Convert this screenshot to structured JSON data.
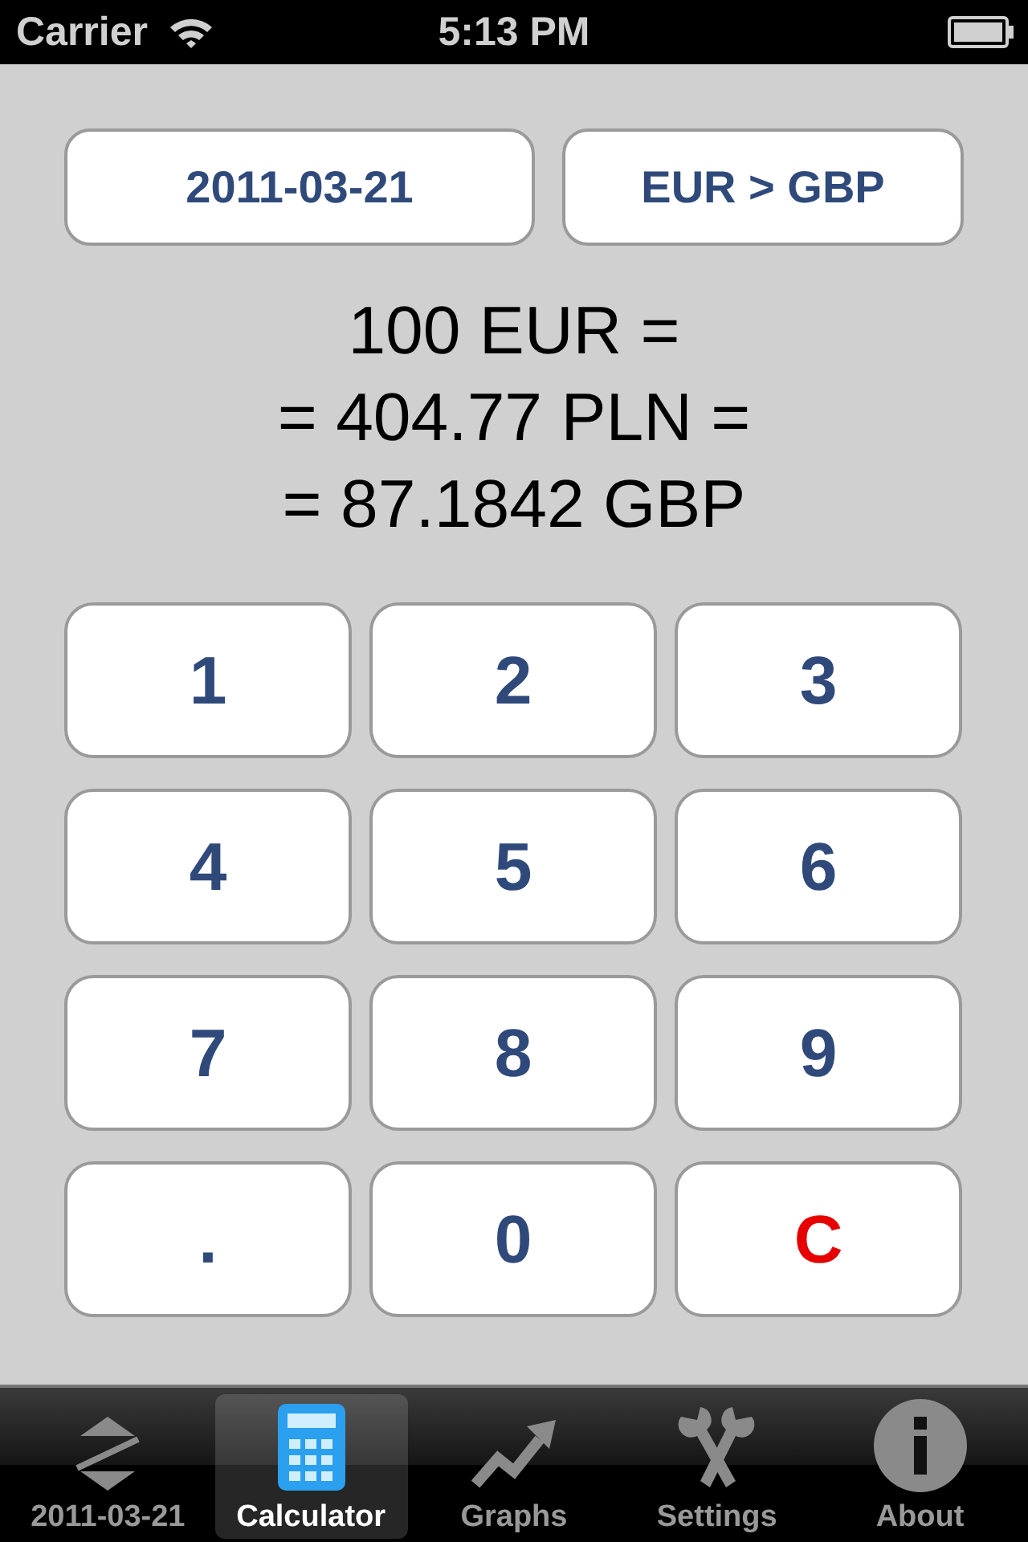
{
  "status_bar": {
    "carrier": "Carrier",
    "time": "5:13 PM"
  },
  "selectors": [
    {
      "label": "2011-03-21"
    },
    {
      "label": "EUR > GBP"
    }
  ],
  "result_lines": [
    "100 EUR =",
    "= 404.77 PLN =",
    "= 87.1842 GBP"
  ],
  "keys": [
    {
      "label": "1",
      "kind": "digit"
    },
    {
      "label": "2",
      "kind": "digit"
    },
    {
      "label": "3",
      "kind": "digit"
    },
    {
      "label": "4",
      "kind": "digit"
    },
    {
      "label": "5",
      "kind": "digit"
    },
    {
      "label": "6",
      "kind": "digit"
    },
    {
      "label": "7",
      "kind": "digit"
    },
    {
      "label": "8",
      "kind": "digit"
    },
    {
      "label": "9",
      "kind": "digit"
    },
    {
      "label": ".",
      "kind": "digit"
    },
    {
      "label": "0",
      "kind": "digit"
    },
    {
      "label": "C",
      "kind": "clear"
    }
  ],
  "tabs": [
    {
      "label": "2011-03-21",
      "kind": "rates",
      "selected": false
    },
    {
      "label": "Calculator",
      "kind": "calculator",
      "selected": true
    },
    {
      "label": "Graphs",
      "kind": "graph",
      "selected": false
    },
    {
      "label": "Settings",
      "kind": "tools",
      "selected": false
    },
    {
      "label": "About",
      "kind": "info",
      "selected": false
    }
  ]
}
